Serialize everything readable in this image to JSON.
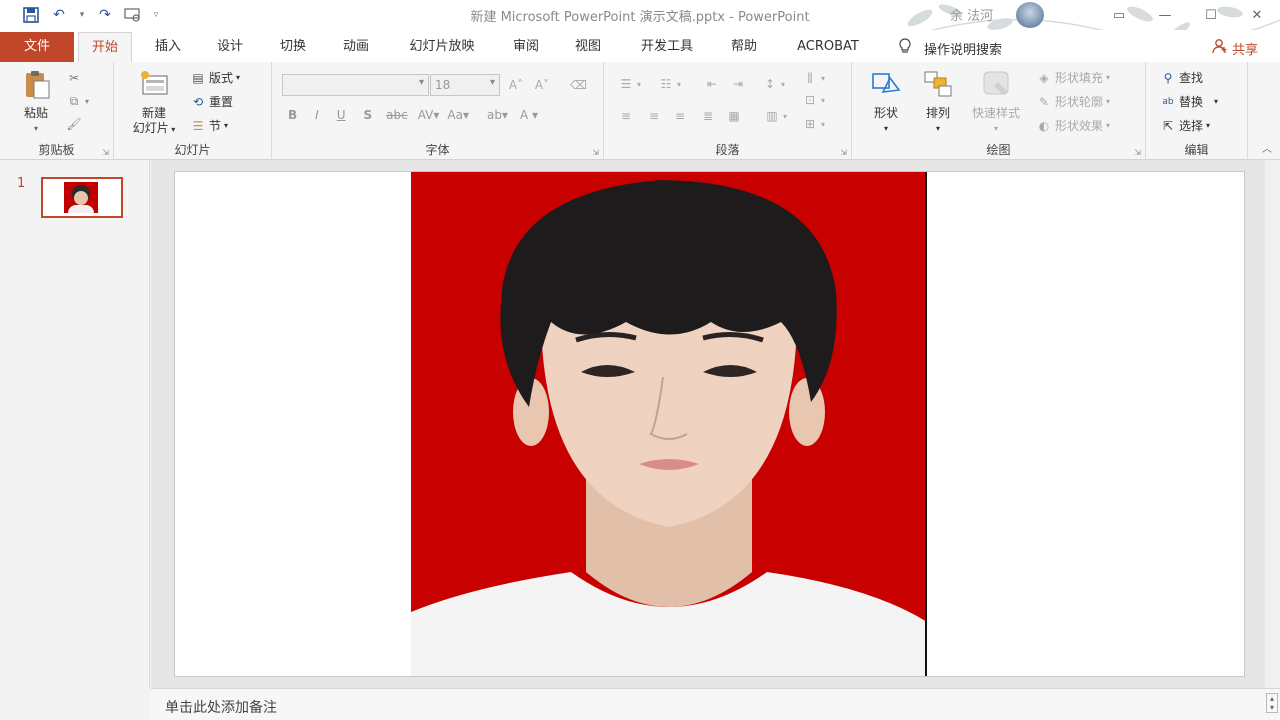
{
  "window": {
    "title": "新建 Microsoft PowerPoint 演示文稿.pptx  -  PowerPoint",
    "user_name": "余 法河"
  },
  "tabs": {
    "file": "文件",
    "items": [
      "开始",
      "插入",
      "设计",
      "切换",
      "动画",
      "幻灯片放映",
      "审阅",
      "视图",
      "开发工具",
      "帮助",
      "ACROBAT"
    ],
    "active": "开始",
    "tell_me": "操作说明搜索",
    "share": "共享"
  },
  "ribbon": {
    "clipboard": {
      "label": "剪贴板",
      "paste": "粘贴"
    },
    "slides": {
      "label": "幻灯片",
      "new_slide_1": "新建",
      "new_slide_2": "幻灯片",
      "layout": "版式",
      "reset": "重置",
      "section": "节"
    },
    "font": {
      "label": "字体",
      "font_name": "",
      "font_size": "18"
    },
    "paragraph": {
      "label": "段落"
    },
    "drawing": {
      "label": "绘图",
      "shapes": "形状",
      "arrange": "排列",
      "quick_styles": "快速样式",
      "shape_fill": "形状填充",
      "shape_outline": "形状轮廓",
      "shape_effects": "形状效果"
    },
    "editing": {
      "label": "编辑",
      "find": "查找",
      "replace": "替换",
      "select": "选择"
    }
  },
  "thumbnails": {
    "slide_number": "1"
  },
  "notes": {
    "placeholder": "单击此处添加备注"
  },
  "colors": {
    "accent": "#c0472a",
    "photo_bg": "#c90000"
  }
}
